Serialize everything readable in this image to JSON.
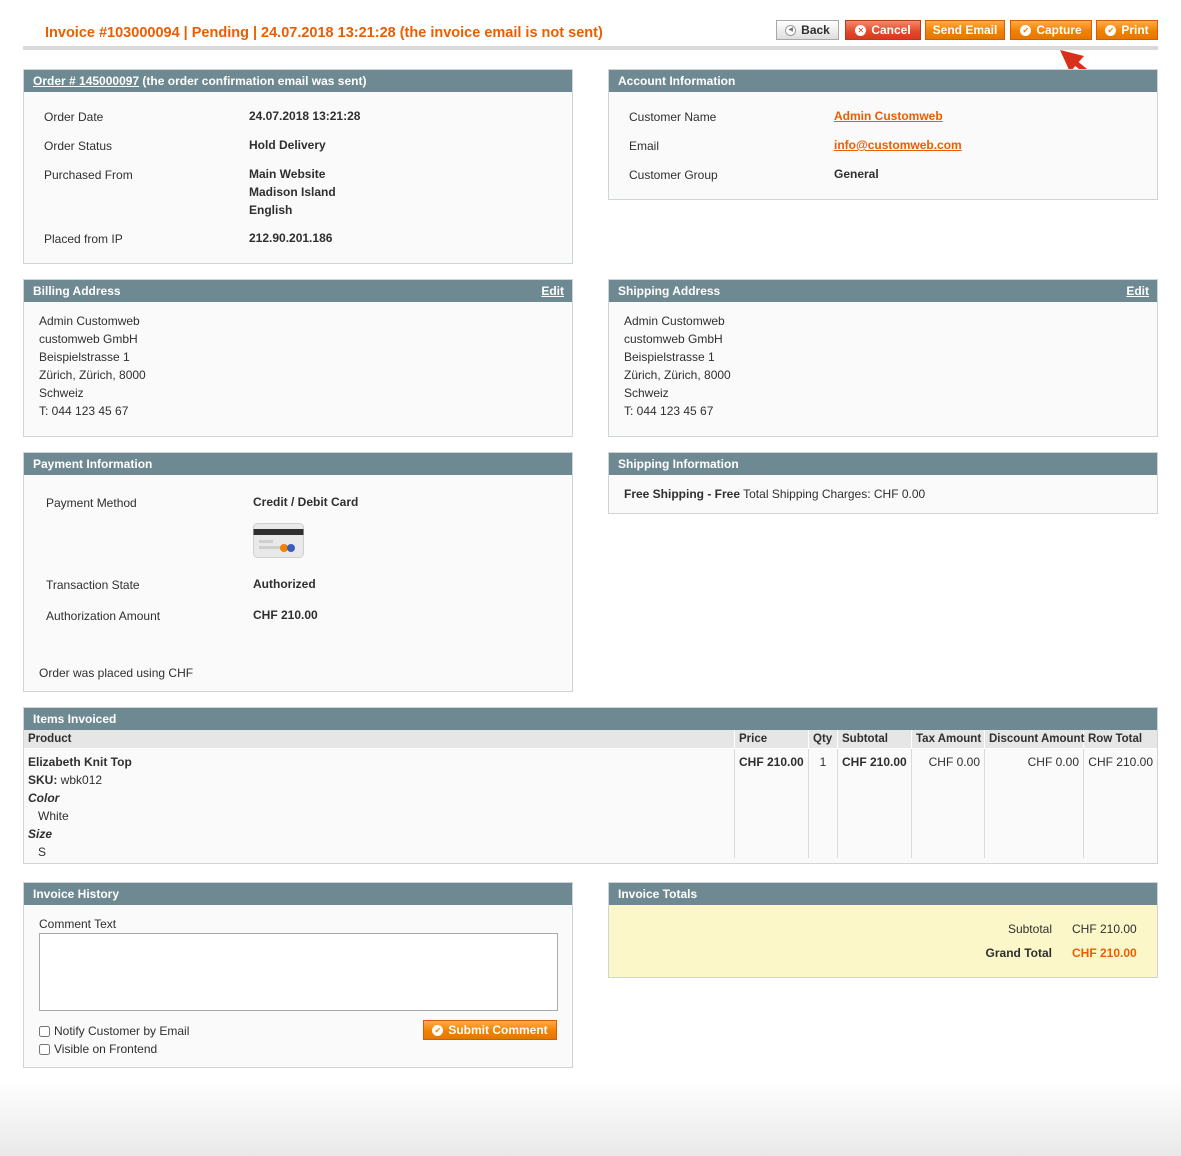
{
  "header": {
    "title": "Invoice #103000094 | Pending | 24.07.2018 13:21:28 (the invoice email is not sent)",
    "buttons": {
      "back": "Back",
      "cancel": "Cancel",
      "send_email": "Send Email",
      "capture": "Capture",
      "print": "Print"
    }
  },
  "order": {
    "link": "Order # 145000097",
    "note": " (the order confirmation email was sent)",
    "rows": {
      "order_date_label": "Order Date",
      "order_date": "24.07.2018 13:21:28",
      "order_status_label": "Order Status",
      "order_status": "Hold Delivery",
      "purchased_from_label": "Purchased From",
      "purchased_from_1": "Main Website",
      "purchased_from_2": "Madison Island",
      "purchased_from_3": "English",
      "placed_ip_label": "Placed from IP",
      "placed_ip": "212.90.201.186"
    }
  },
  "account": {
    "title": "Account Information",
    "customer_name_label": "Customer Name",
    "customer_name": "Admin Customweb",
    "email_label": "Email",
    "email": "info@customweb.com",
    "group_label": "Customer Group",
    "group": "General"
  },
  "billing": {
    "title": "Billing Address",
    "edit": "Edit",
    "lines": [
      "Admin Customweb",
      "customweb GmbH",
      "Beispielstrasse 1",
      "Zürich, Zürich, 8000",
      "Schweiz",
      "T: 044 123 45 67"
    ]
  },
  "shipping": {
    "title": "Shipping Address",
    "edit": "Edit",
    "lines": [
      "Admin Customweb",
      "customweb GmbH",
      "Beispielstrasse 1",
      "Zürich, Zürich, 8000",
      "Schweiz",
      "T: 044 123 45 67"
    ]
  },
  "payment": {
    "title": "Payment Information",
    "method_label": "Payment Method",
    "method": "Credit / Debit Card",
    "state_label": "Transaction State",
    "state": "Authorized",
    "amount_label": "Authorization Amount",
    "amount": "CHF 210.00",
    "currency_note": "Order was placed using CHF"
  },
  "shipping_info": {
    "title": "Shipping Information",
    "method": "Free Shipping - Free",
    "charges": " Total Shipping Charges: CHF 0.00"
  },
  "items": {
    "title": "Items Invoiced",
    "columns": [
      "Product",
      "Price",
      "Qty",
      "Subtotal",
      "Tax Amount",
      "Discount Amount",
      "Row Total"
    ],
    "row": {
      "product": "Elizabeth Knit Top",
      "sku_label": "SKU:",
      "sku": " wbk012",
      "color_label": "Color",
      "color": "White",
      "size_label": "Size",
      "size": "S",
      "price": "CHF 210.00",
      "qty": "1",
      "subtotal": "CHF 210.00",
      "tax": "CHF 0.00",
      "discount": "CHF 0.00",
      "row_total": "CHF 210.00"
    }
  },
  "history": {
    "title": "Invoice History",
    "comment_label": "Comment Text",
    "notify_label": "Notify Customer by Email",
    "visible_label": "Visible on Frontend",
    "submit": "Submit Comment"
  },
  "totals": {
    "title": "Invoice Totals",
    "subtotal_label": "Subtotal",
    "subtotal": "CHF 210.00",
    "grand_label": "Grand Total",
    "grand": "CHF 210.00"
  },
  "colors": {
    "accent": "#eb5e00",
    "header_bar": "#6f8992",
    "button_orange": "#f18200",
    "arrow": "#e2341d"
  }
}
